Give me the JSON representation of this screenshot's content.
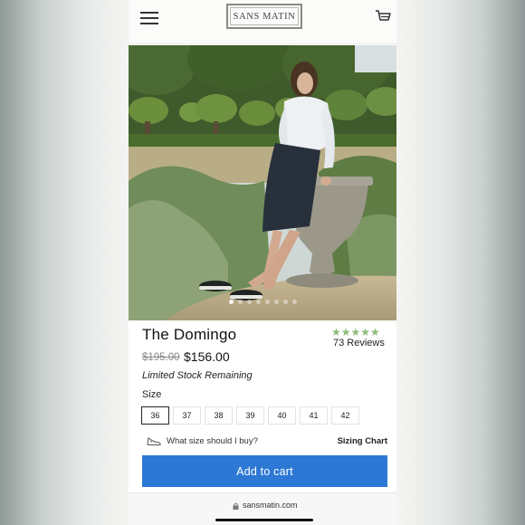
{
  "header": {
    "logo_text": "SANS MATIN",
    "menu_icon": "hamburger-menu-icon",
    "cart_icon": "shopping-cart-icon"
  },
  "gallery": {
    "image_count": 8,
    "active_index": 0
  },
  "product": {
    "title": "The Domingo",
    "rating_stars": "★★★★★",
    "rating": 5,
    "reviews": "73 Reviews",
    "old_price": "$195.00",
    "price": "$156.00",
    "stock_note": "Limited Stock Remaining"
  },
  "size": {
    "label": "Size",
    "options": [
      "36",
      "37",
      "38",
      "39",
      "40",
      "41",
      "42"
    ],
    "selected": "36"
  },
  "size_help": {
    "icon": "shoe-icon",
    "question": "What size should I buy?",
    "chart_link": "Sizing Chart"
  },
  "cta": {
    "add_to_cart": "Add to cart",
    "color": "#2e78d5"
  },
  "browser": {
    "url": "sansmatin.com"
  },
  "accent_colors": {
    "stars": "#8dbb78",
    "button": "#2e78d5"
  }
}
